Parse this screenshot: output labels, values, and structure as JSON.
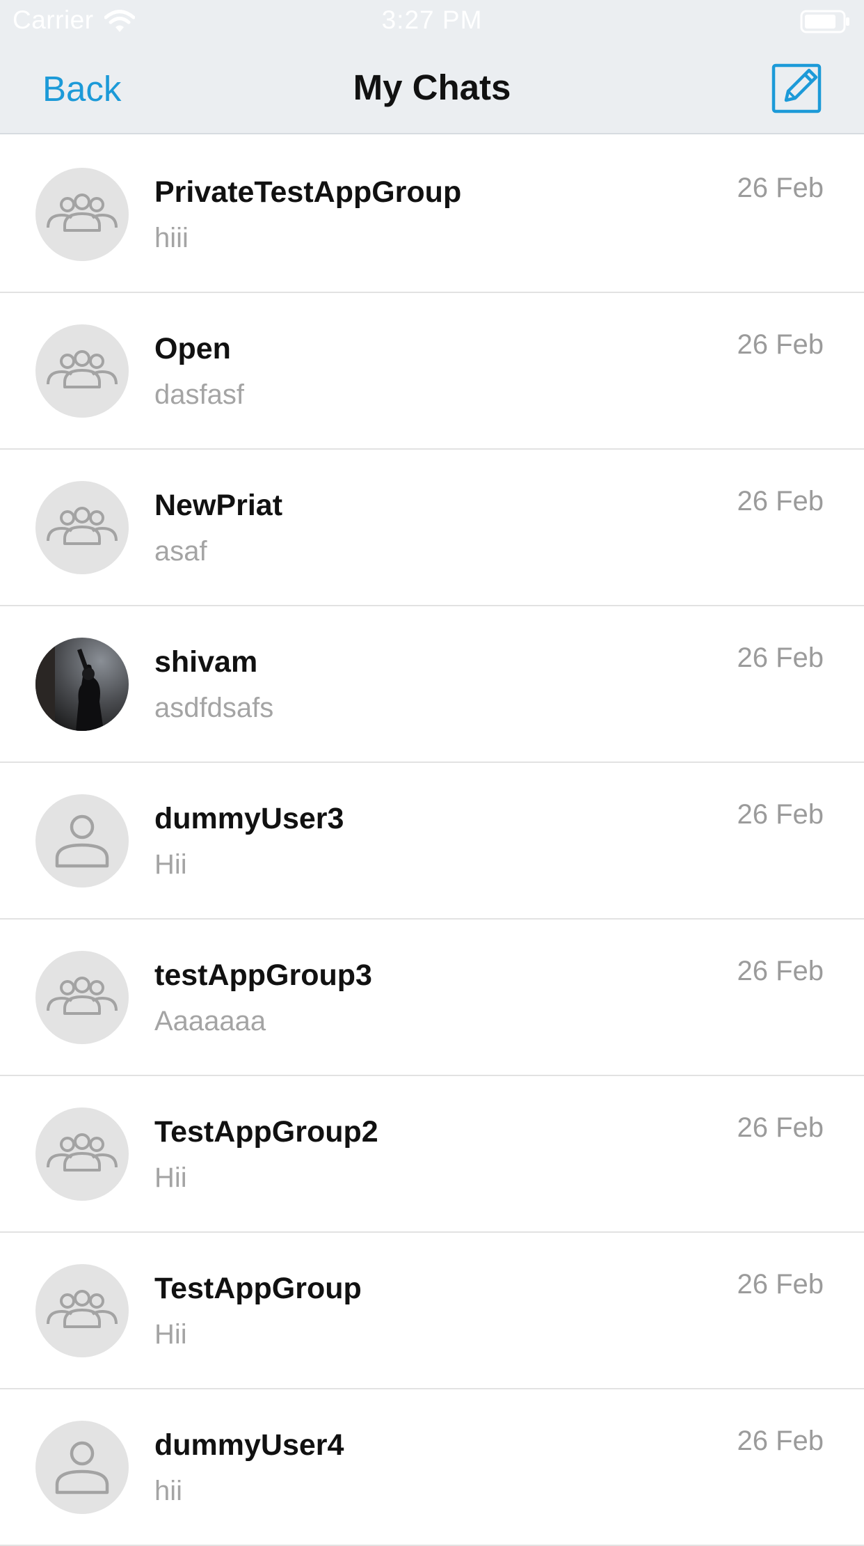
{
  "status_bar": {
    "carrier": "Carrier",
    "time": "3:27 PM"
  },
  "nav": {
    "back_label": "Back",
    "title": "My Chats",
    "compose_icon": "compose-icon"
  },
  "colors": {
    "accent": "#1c9ad8",
    "header_bg": "#ebeef1",
    "avatar_bg": "#e3e3e3"
  },
  "chats": [
    {
      "name": "PrivateTestAppGroup",
      "preview": "hiii",
      "date": "26 Feb",
      "avatar": "group-icon"
    },
    {
      "name": "Open",
      "preview": "dasfasf",
      "date": "26 Feb",
      "avatar": "group-icon"
    },
    {
      "name": "NewPriat",
      "preview": "asaf",
      "date": "26 Feb",
      "avatar": "group-icon"
    },
    {
      "name": "shivam",
      "preview": "asdfdsafs",
      "date": "26 Feb",
      "avatar": "user-photo"
    },
    {
      "name": "dummyUser3",
      "preview": "Hii",
      "date": "26 Feb",
      "avatar": "user-icon"
    },
    {
      "name": "testAppGroup3",
      "preview": "Aaaaaaa",
      "date": "26 Feb",
      "avatar": "group-icon"
    },
    {
      "name": "TestAppGroup2",
      "preview": "Hii",
      "date": "26 Feb",
      "avatar": "group-icon"
    },
    {
      "name": "TestAppGroup",
      "preview": "Hii",
      "date": "26 Feb",
      "avatar": "group-icon"
    },
    {
      "name": "dummyUser4",
      "preview": "hii",
      "date": "26 Feb",
      "avatar": "user-icon"
    }
  ]
}
